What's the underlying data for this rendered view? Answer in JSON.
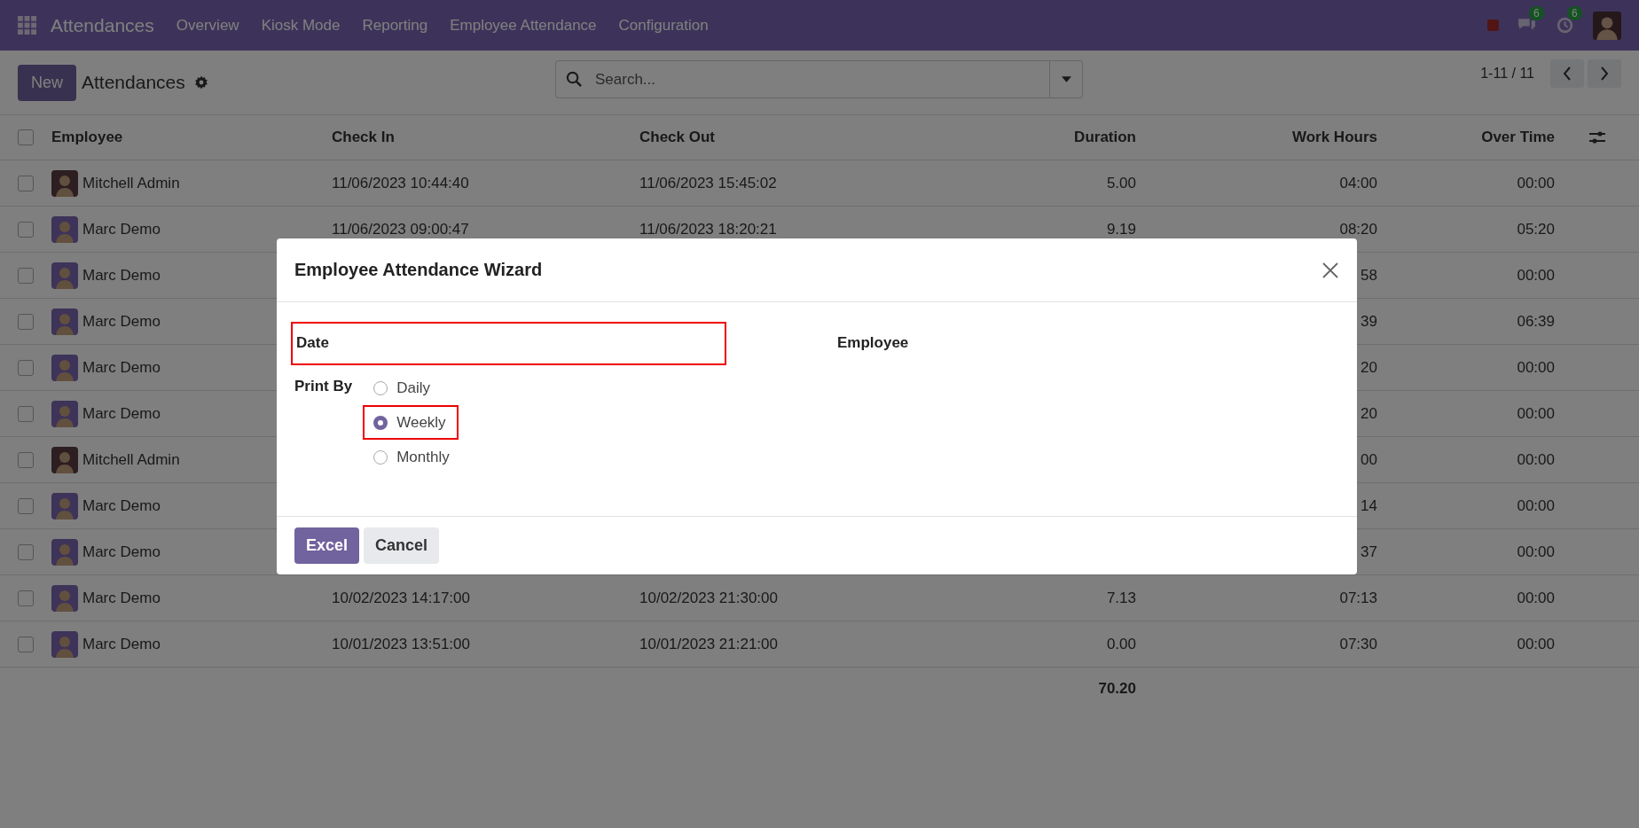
{
  "navbar": {
    "brand": "Attendances",
    "menu": [
      "Overview",
      "Kiosk Mode",
      "Reporting",
      "Employee Attendance",
      "Configuration"
    ],
    "messages_badge": "6",
    "activities_badge": "6"
  },
  "control_panel": {
    "new_button": "New",
    "title": "Attendances",
    "search": {
      "placeholder": "Search..."
    },
    "pager": "1-11 / 11"
  },
  "table": {
    "header_checked": false,
    "columns": [
      "Employee",
      "Check In",
      "Check Out",
      "Duration",
      "Work Hours",
      "Over Time"
    ],
    "rows": [
      {
        "checked": false,
        "employee": "Mitchell Admin",
        "color": "#2d1e22",
        "check_in": "11/06/2023 10:44:40",
        "check_out": "11/06/2023 15:45:02",
        "duration": "5.00",
        "work_hours": "04:00",
        "over_time": "00:00"
      },
      {
        "checked": false,
        "employee": "Marc Demo",
        "color": "#3e3358",
        "check_in": "11/06/2023 09:00:47",
        "check_out": "11/06/2023 18:20:21",
        "duration": "9.19",
        "work_hours": "08:20",
        "over_time": "05:20"
      },
      {
        "checked": false,
        "employee": "Marc Demo",
        "color": "#3e3358",
        "work_hours": "58",
        "over_time": "00:00"
      },
      {
        "checked": false,
        "employee": "Marc Demo",
        "color": "#3e3358",
        "work_hours": "39",
        "over_time": "06:39"
      },
      {
        "checked": false,
        "employee": "Marc Demo",
        "color": "#3e3358",
        "work_hours": "20",
        "over_time": "00:00"
      },
      {
        "checked": false,
        "employee": "Marc Demo",
        "color": "#3e3358",
        "work_hours": "20",
        "over_time": "00:00"
      },
      {
        "checked": false,
        "employee": "Mitchell Admin",
        "color": "#2d1e22",
        "work_hours": "00",
        "over_time": "00:00"
      },
      {
        "checked": false,
        "employee": "Marc Demo",
        "color": "#3e3358",
        "work_hours": "14",
        "over_time": "00:00"
      },
      {
        "checked": false,
        "employee": "Marc Demo",
        "color": "#3e3358",
        "work_hours": "37",
        "over_time": "00:00"
      },
      {
        "checked": false,
        "employee": "Marc Demo",
        "color": "#3e3358",
        "check_in": "10/02/2023 14:17:00",
        "check_out": "10/02/2023 21:30:00",
        "duration": "7.13",
        "work_hours": "07:13",
        "over_time": "00:00"
      },
      {
        "checked": false,
        "employee": "Marc Demo",
        "color": "#3e3358",
        "check_in": "10/01/2023 13:51:00",
        "check_out": "10/01/2023 21:21:00",
        "duration": "0.00",
        "work_hours": "07:30",
        "over_time": "00:00"
      }
    ],
    "total_duration": "70.20"
  },
  "dialog": {
    "title": "Employee Attendance Wizard",
    "date": {
      "label": "Date",
      "highlighted": true
    },
    "employee": {
      "label": "Employee"
    },
    "print_by": {
      "label": "Print By",
      "options": [
        {
          "label": "Daily",
          "selected": false,
          "highlighted": false
        },
        {
          "label": "Weekly",
          "selected": true,
          "highlighted": true
        },
        {
          "label": "Monthly",
          "selected": false,
          "highlighted": false
        }
      ]
    },
    "buttons": [
      {
        "label": "Excel",
        "kind": "primary"
      },
      {
        "label": "Cancel",
        "kind": "secondary"
      }
    ]
  }
}
